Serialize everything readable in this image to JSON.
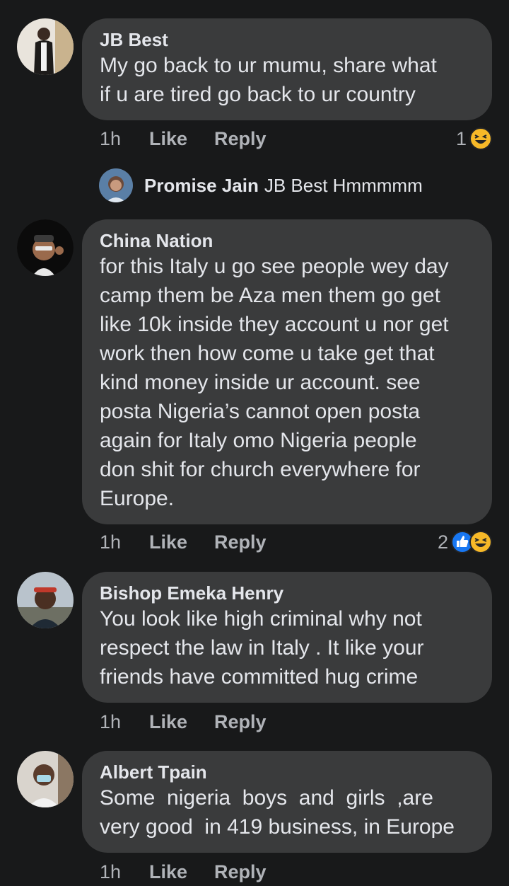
{
  "comments": [
    {
      "author": "JB Best",
      "text": "My go back to ur mumu, share what\nif u are tired go back to ur country",
      "time": "1h",
      "like": "Like",
      "reply": "Reply",
      "reaction_count": "1",
      "reactions": [
        "laughing-emoji"
      ]
    },
    {
      "author": "China Nation",
      "text": "for this Italy u go see people wey day\ncamp them be Aza men them go get\nlike 10k inside they account u nor get\nwork then how come u take get that\nkind money inside ur account. see\nposta Nigeria’s cannot open posta\nagain for Italy omo Nigeria people\ndon shit for church everywhere for\nEurope.",
      "time": "1h",
      "like": "Like",
      "reply": "Reply",
      "reaction_count": "2",
      "reactions": [
        "like-thumb",
        "laughing-emoji"
      ]
    },
    {
      "author": "Bishop Emeka Henry",
      "text": "You look like high criminal why not\nrespect the law in Italy . It like your\nfriends have committed hug crime",
      "time": "1h",
      "like": "Like",
      "reply": "Reply"
    },
    {
      "author": "Albert Tpain",
      "text": "Some  nigeria  boys  and  girls  ,are\nvery good  in 419 business, in Europe",
      "time": "1h",
      "like": "Like",
      "reply": "Reply"
    }
  ],
  "reply_preview": {
    "author": "Promise Jain",
    "text": "JB Best Hmmmmm"
  },
  "colors": {
    "background": "#18191a",
    "bubble": "#3a3b3c",
    "text": "#e4e6eb",
    "secondary": "#b0b3b8",
    "like_blue": "#1877f2",
    "haha_yellow": "#f7b928"
  }
}
